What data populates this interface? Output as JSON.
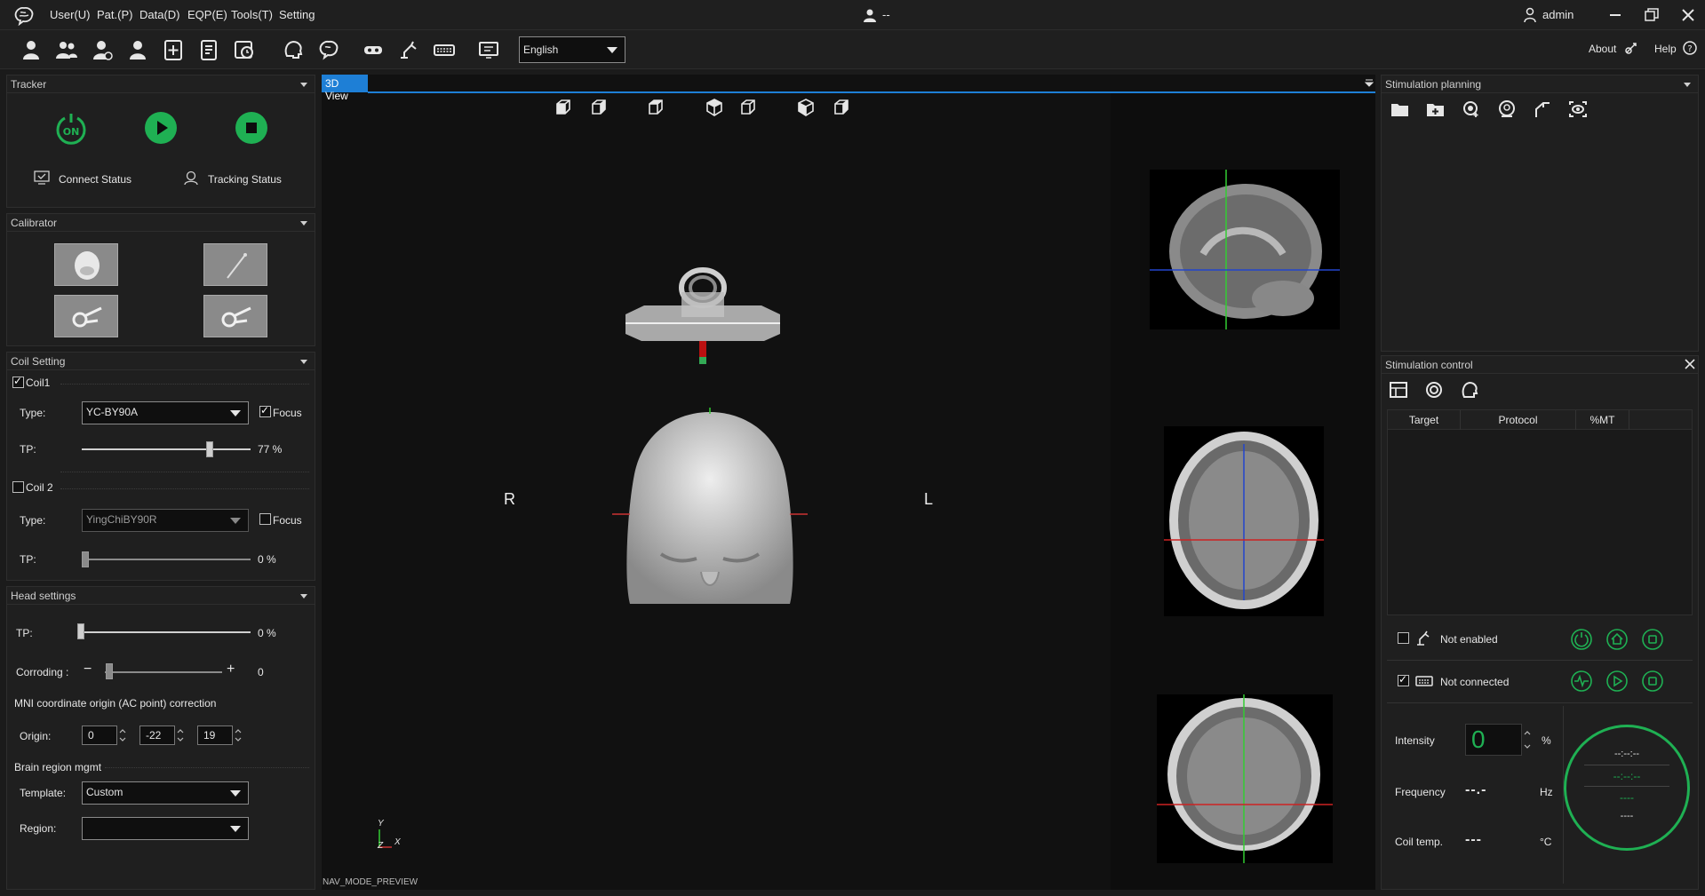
{
  "menu": {
    "items": [
      "User(U)",
      "Pat.(P)",
      "Data(D)",
      "EQP(E)",
      "Tools(T)",
      "Setting"
    ],
    "center_user": "--",
    "account": "admin"
  },
  "toolbar": {
    "icons": [
      "user-icon",
      "users-icon",
      "patient-icon",
      "patient-alt-icon",
      "add-record-icon",
      "report-icon",
      "history-icon",
      "head-icon",
      "brain-icon",
      "coil-icon",
      "arm-icon",
      "keyboard-icon",
      "monitor-icon"
    ],
    "language": "English",
    "about": "About",
    "help": "Help"
  },
  "tracker": {
    "title": "Tracker",
    "on_label": "ON",
    "connect_status": "Connect Status",
    "tracking_status": "Tracking Status"
  },
  "calibrator": {
    "title": "Calibrator"
  },
  "coil_setting": {
    "title": "Coil Setting",
    "coil1": {
      "label": "Coil1",
      "checked": true,
      "type_label": "Type:",
      "type": "YC-BY90A",
      "focus_label": "Focus",
      "focus_checked": true,
      "tp_label": "TP:",
      "tp": "77 %",
      "tp_fraction": 0.77
    },
    "coil2": {
      "label": "Coil 2",
      "checked": false,
      "type_label": "Type:",
      "type": "YingChiBY90R",
      "focus_label": "Focus",
      "focus_checked": false,
      "tp_label": "TP:",
      "tp": "0 %",
      "tp_fraction": 0
    }
  },
  "head_settings": {
    "title": "Head settings",
    "tp_label": "TP:",
    "tp": "0 %",
    "corroding_label": "Corroding :",
    "corroding_minus": "−",
    "corroding_plus": "+",
    "corroding": "0",
    "mni_title": "MNI coordinate origin (AC point) correction",
    "origin_label": "Origin:",
    "origin": [
      "0",
      "-22",
      "19"
    ],
    "brain_region_title": "Brain region mgmt",
    "template_label": "Template:",
    "template": "Custom",
    "region_label": "Region:",
    "region": ""
  },
  "view3d": {
    "tab": "3D View",
    "left_label": "R",
    "right_label": "L",
    "axis_y": "Y",
    "axis_z": "Z",
    "axis_x": "X",
    "mode": "NAV_MODE_PREVIEW"
  },
  "stim_planning": {
    "title": "Stimulation planning"
  },
  "stim_control": {
    "title": "Stimulation control",
    "columns": [
      "Target",
      "Protocol",
      "%MT"
    ],
    "row1": {
      "label": "Not enabled",
      "checked": false
    },
    "row2": {
      "label": "Not connected",
      "checked": true
    },
    "intensity_label": "Intensity",
    "intensity": "0",
    "intensity_unit": "%",
    "frequency_label": "Frequency",
    "frequency": "--.-",
    "frequency_unit": "Hz",
    "coil_temp_label": "Coil temp.",
    "coil_temp": "---",
    "coil_temp_unit": "°C",
    "gauge": [
      "--:--:--",
      "--:--:--",
      "----",
      "----"
    ]
  },
  "colors": {
    "accent_green": "#1fb053",
    "accent_blue": "#1e7fd6",
    "background": "#1b1b1b"
  }
}
